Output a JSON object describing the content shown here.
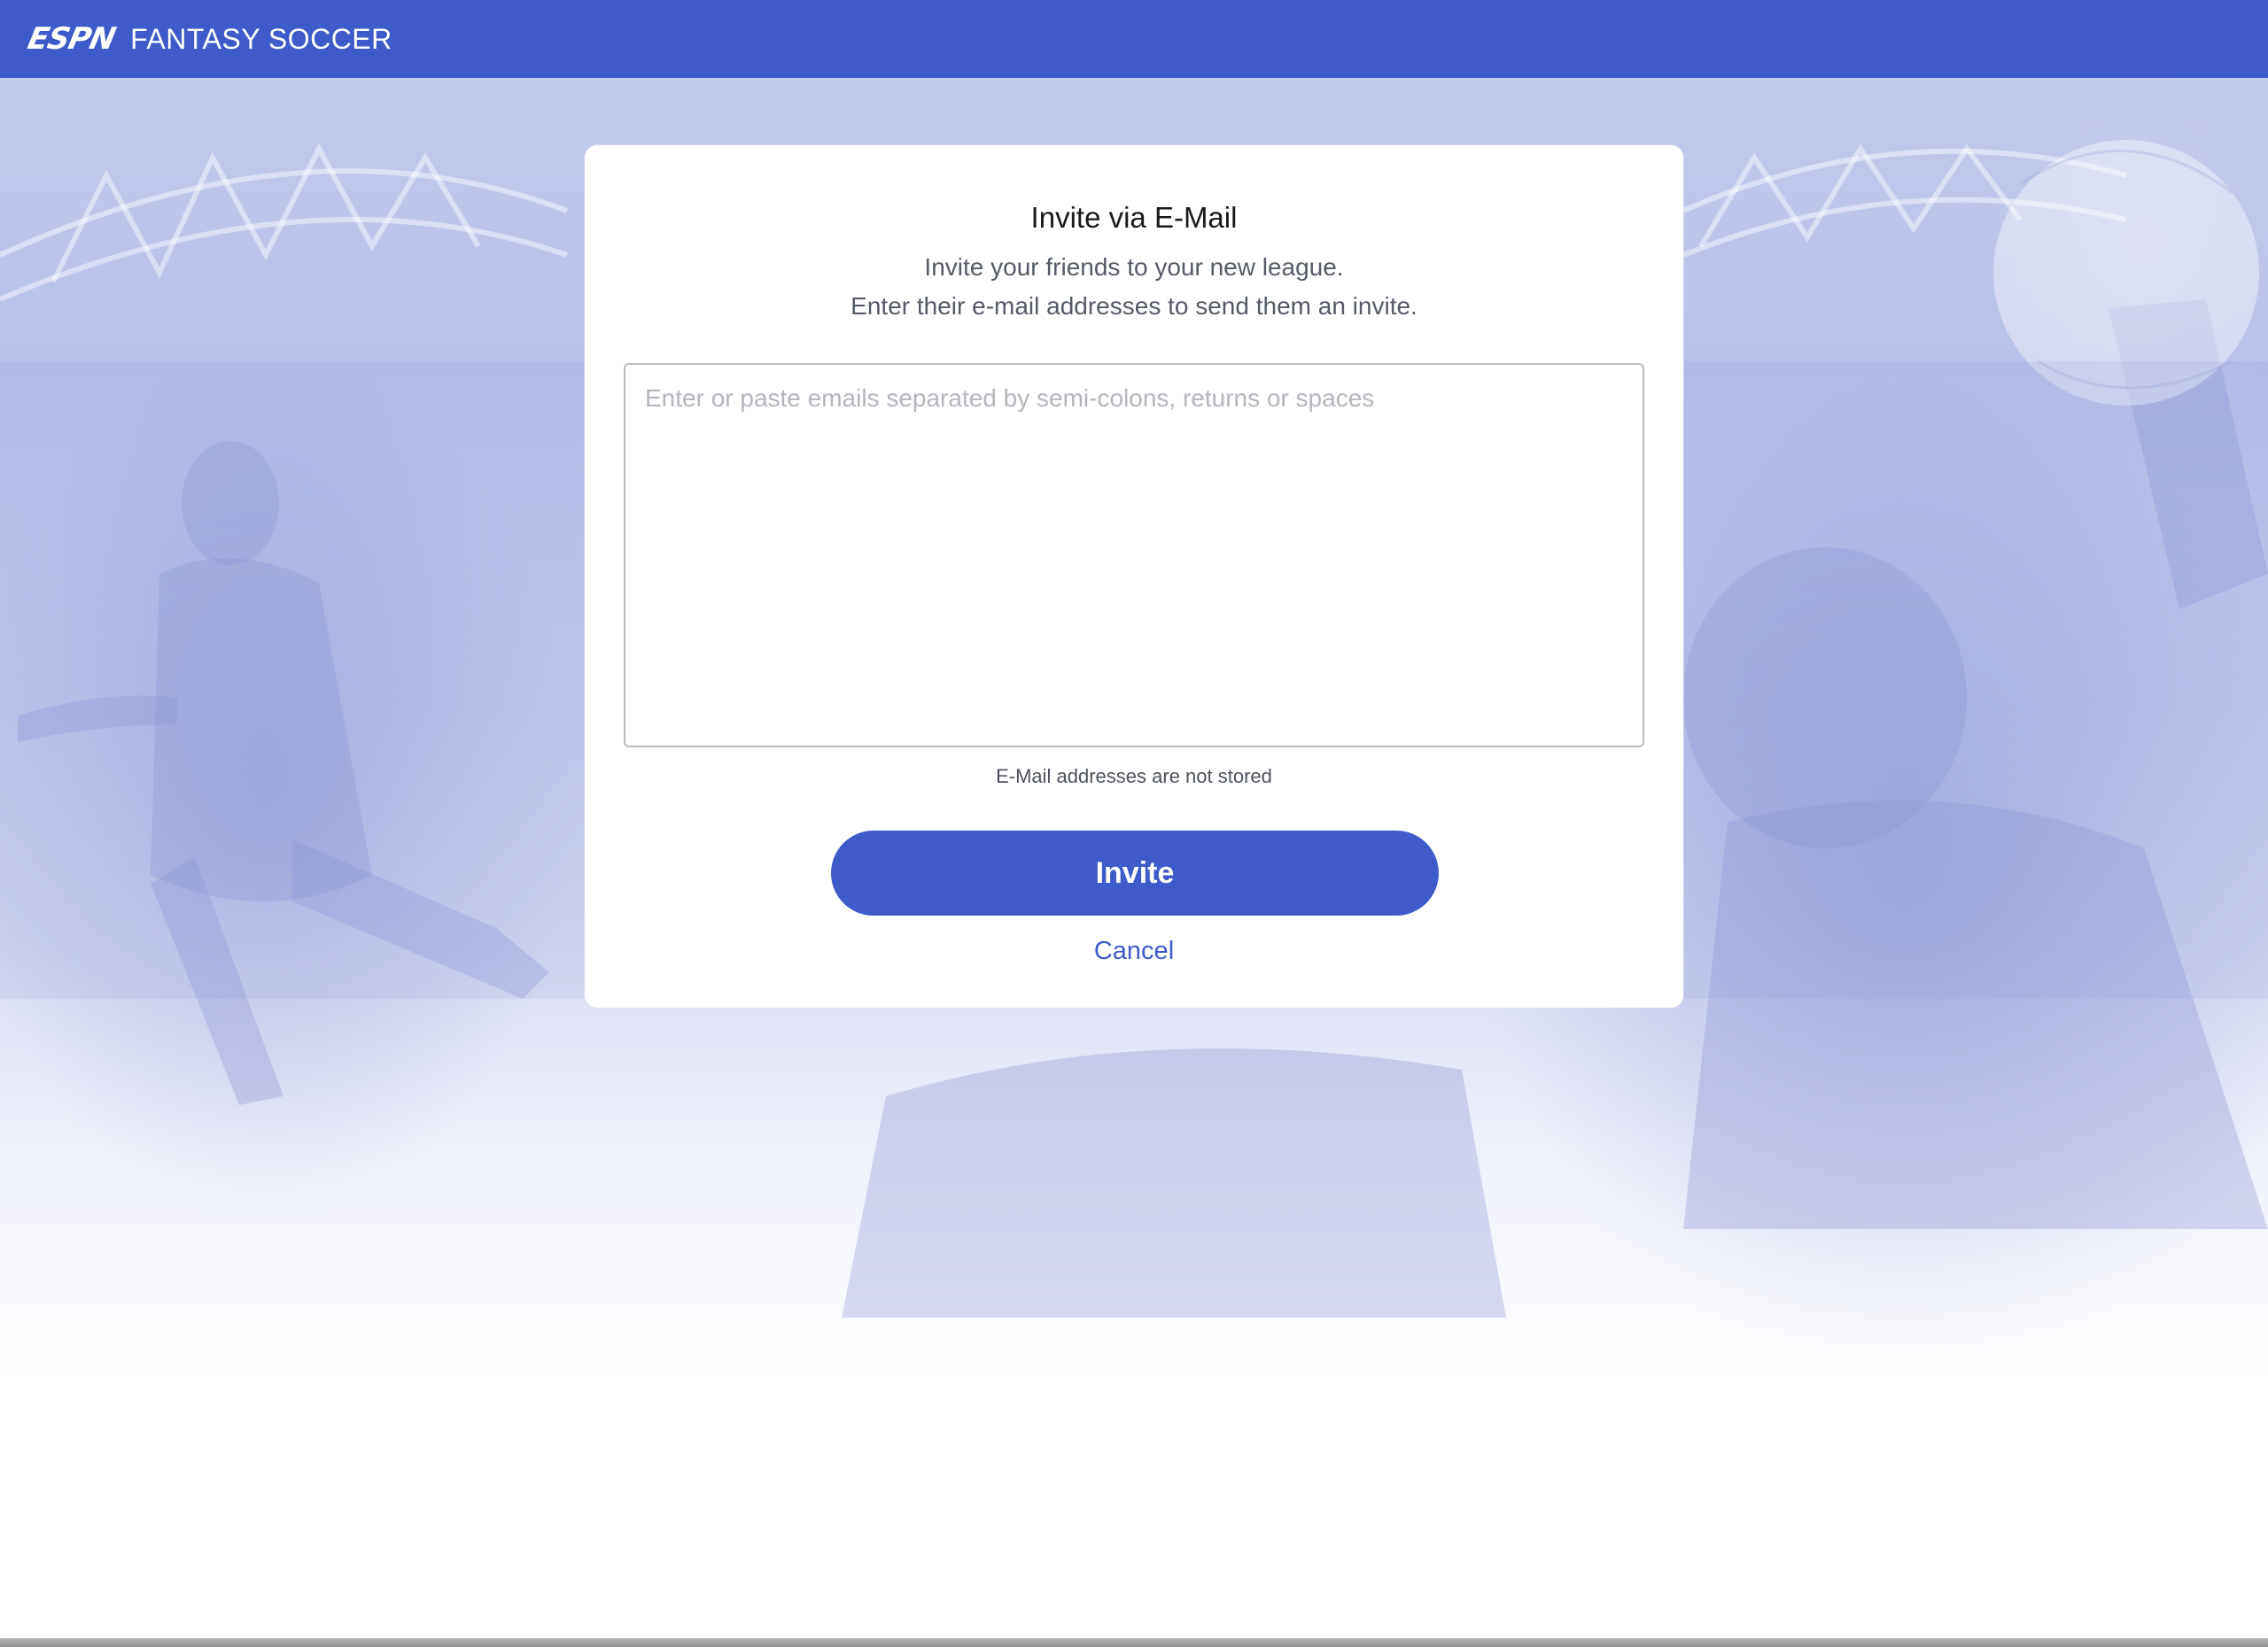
{
  "header": {
    "logo_text": "ESPN",
    "title": "FANTASY SOCCER"
  },
  "dialog": {
    "title": "Invite via E-Mail",
    "subtitle_line1": "Invite your friends to your new league.",
    "subtitle_line2": "Enter their e-mail addresses to send them an invite.",
    "email_input": {
      "value": "",
      "placeholder": "Enter or paste emails separated by semi-colons, returns or spaces"
    },
    "storage_note": "E-Mail addresses are not stored",
    "invite_label": "Invite",
    "cancel_label": "Cancel"
  },
  "colors": {
    "brand_blue": "#3f5ac9",
    "background_tint": "#c3cbeb"
  }
}
